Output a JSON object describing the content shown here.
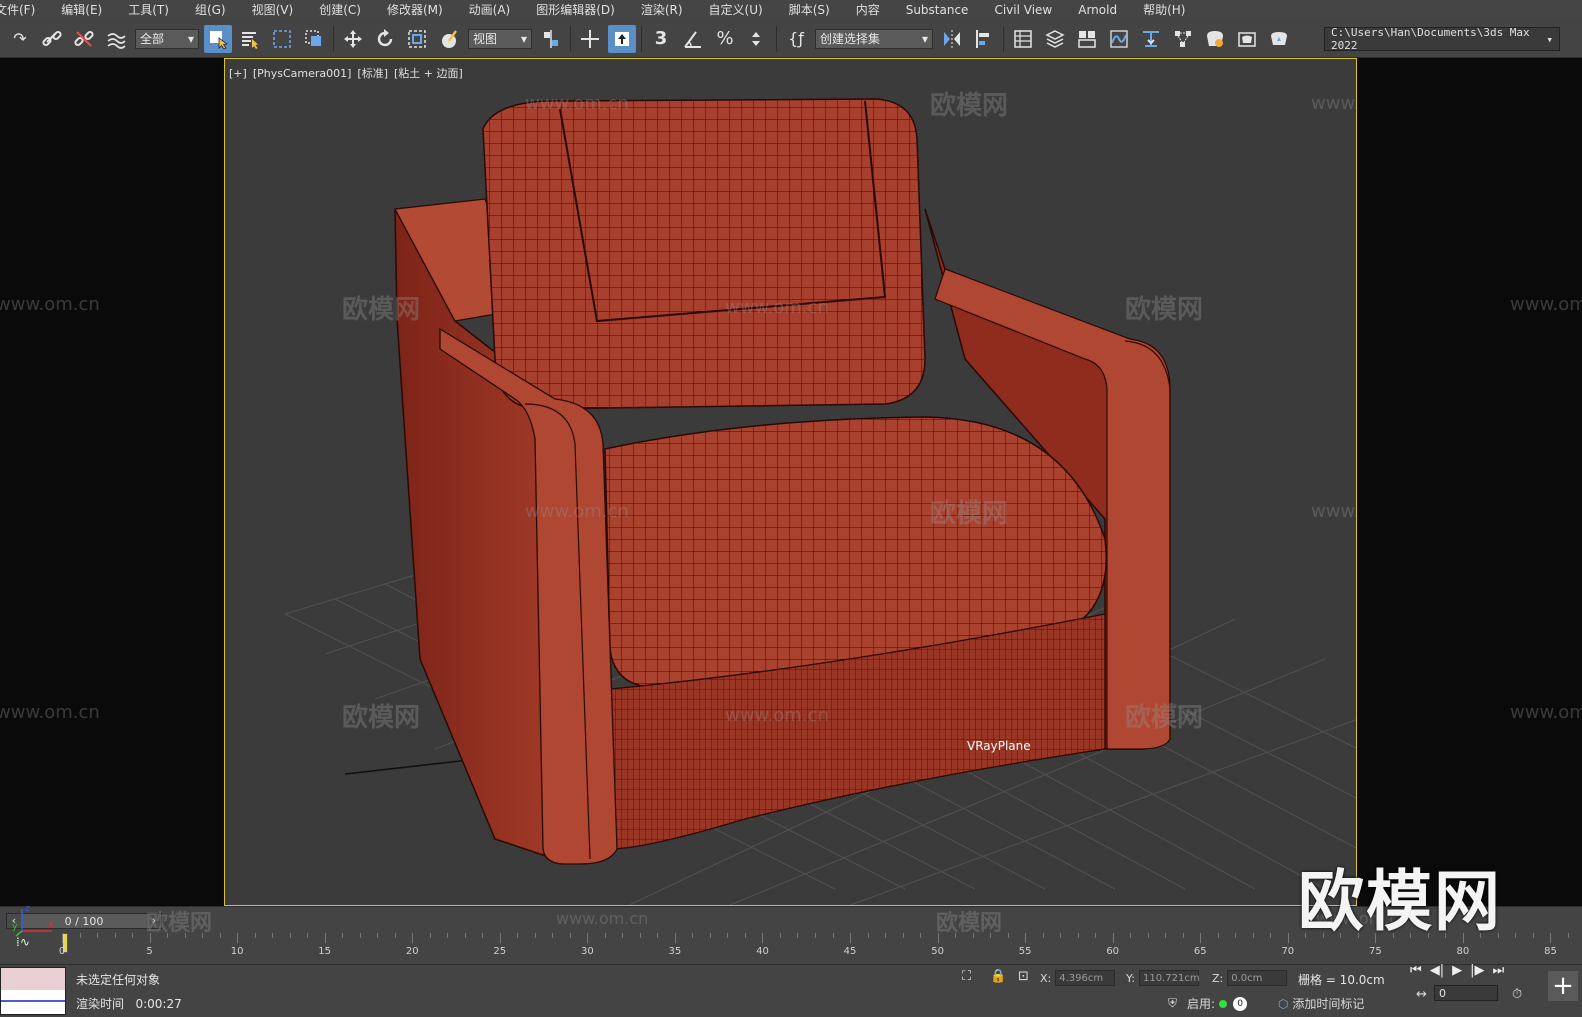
{
  "menu": [
    {
      "label": "文件(F)"
    },
    {
      "label": "编辑(E)"
    },
    {
      "label": "工具(T)"
    },
    {
      "label": "组(G)"
    },
    {
      "label": "视图(V)"
    },
    {
      "label": "创建(C)"
    },
    {
      "label": "修改器(M)"
    },
    {
      "label": "动画(A)"
    },
    {
      "label": "图形编辑器(D)"
    },
    {
      "label": "渲染(R)"
    },
    {
      "label": "自定义(U)"
    },
    {
      "label": "脚本(S)"
    },
    {
      "label": "内容"
    },
    {
      "label": "Substance"
    },
    {
      "label": "Civil View"
    },
    {
      "label": "Arnold"
    },
    {
      "label": "帮助(H)"
    }
  ],
  "toolbar": {
    "selection_filter": "全部",
    "reference_coord": "视图",
    "named_selection": "创建选择集",
    "snap_label": "3"
  },
  "project_path": "C:\\Users\\Han\\Documents\\3ds Max 2022",
  "viewport": {
    "label_plus": "[+]",
    "label_camera": "[PhysCamera001]",
    "label_shading": "[标准]",
    "label_mode": "[粘土 + 边面]",
    "object_label": "VRayPlane",
    "logo_watermark": "欧模网",
    "watermark_text": "欧模网",
    "watermark_url": "www.om.cn"
  },
  "timeline": {
    "frame_counter": "0 / 100",
    "ticks": [
      0,
      5,
      10,
      15,
      20,
      25,
      30,
      35,
      40,
      45,
      50,
      55,
      60,
      65,
      70,
      75,
      80,
      85
    ]
  },
  "status": {
    "selection": "未选定任何对象",
    "render_time_label": "渲染时间",
    "render_time": "0:00:27",
    "x_label": "X:",
    "x_value": "4.396cm",
    "y_label": "Y:",
    "y_value": "110.721cm",
    "z_label": "Z:",
    "z_value": "0.0cm",
    "grid": "栅格 = 10.0cm",
    "enabled_label": "启用:",
    "enabled_count": "0",
    "add_time_tag": "添加时间标记",
    "current_frame": "0"
  },
  "colors": {
    "viewport_border": "#d8c332",
    "active_tool": "#5b8fc8",
    "chair_fill": "#a8402f"
  }
}
